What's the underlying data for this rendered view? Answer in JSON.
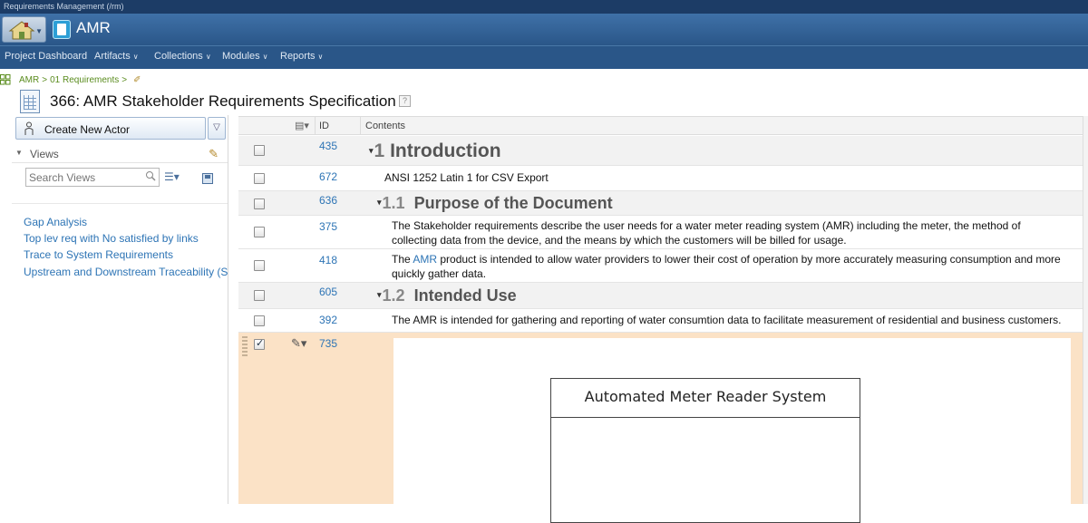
{
  "app": {
    "strip_title": "Requirements Management (/rm)",
    "project_name": "AMR"
  },
  "nav": [
    {
      "label": "Project Dashboard",
      "has_menu": false
    },
    {
      "label": "Artifacts",
      "has_menu": true
    },
    {
      "label": "Collections",
      "has_menu": true
    },
    {
      "label": "Modules",
      "has_menu": true
    },
    {
      "label": "Reports",
      "has_menu": true
    }
  ],
  "breadcrumb": {
    "items": [
      "AMR",
      "01 Requirements"
    ],
    "separator": ">"
  },
  "page": {
    "title": "366: AMR Stakeholder Requirements Specification",
    "help_glyph": "?"
  },
  "left_panel": {
    "create_button_label": "Create New Actor",
    "views_label": "Views",
    "search_placeholder": "Search Views",
    "views": [
      "Gap Analysis",
      "Top lev req with No satisfied by links",
      "Trace to System Requirements",
      "Upstream and Downstream Traceability (Sa"
    ]
  },
  "grid": {
    "headers": {
      "id": "ID",
      "contents": "Contents"
    },
    "rows": [
      {
        "id": "435",
        "kind": "h1",
        "num": "1",
        "text": "Introduction"
      },
      {
        "id": "672",
        "kind": "text",
        "text": "ANSI 1252 Latin 1 for CSV Export"
      },
      {
        "id": "636",
        "kind": "h2",
        "num": "1.1",
        "text": "Purpose of the Document"
      },
      {
        "id": "375",
        "kind": "text",
        "text": "The Stakeholder requirements describe the user needs for a water meter reading system (AMR) including the meter, the method of collecting data from the device, and the means by which the customers will be billed for usage."
      },
      {
        "id": "418",
        "kind": "text_link",
        "pre": "The ",
        "link": "AMR",
        "post": " product is intended to allow water providers to lower their cost of operation by more accurately measuring consumption and more quickly gather data."
      },
      {
        "id": "605",
        "kind": "h2",
        "num": "1.2",
        "text": "Intended Use"
      },
      {
        "id": "392",
        "kind": "text",
        "text": "The AMR is intended for gathering and reporting of water consumtion data to facilitate measurement of residential and business customers."
      },
      {
        "id": "735",
        "kind": "diagram",
        "selected": true,
        "diagram_title": "Automated Meter Reader System"
      }
    ]
  },
  "colors": {
    "header_bg": "#2a5688",
    "link": "#2d74b5",
    "breadcrumb": "#5a8c1e",
    "selected_row": "#fbe2c6"
  }
}
